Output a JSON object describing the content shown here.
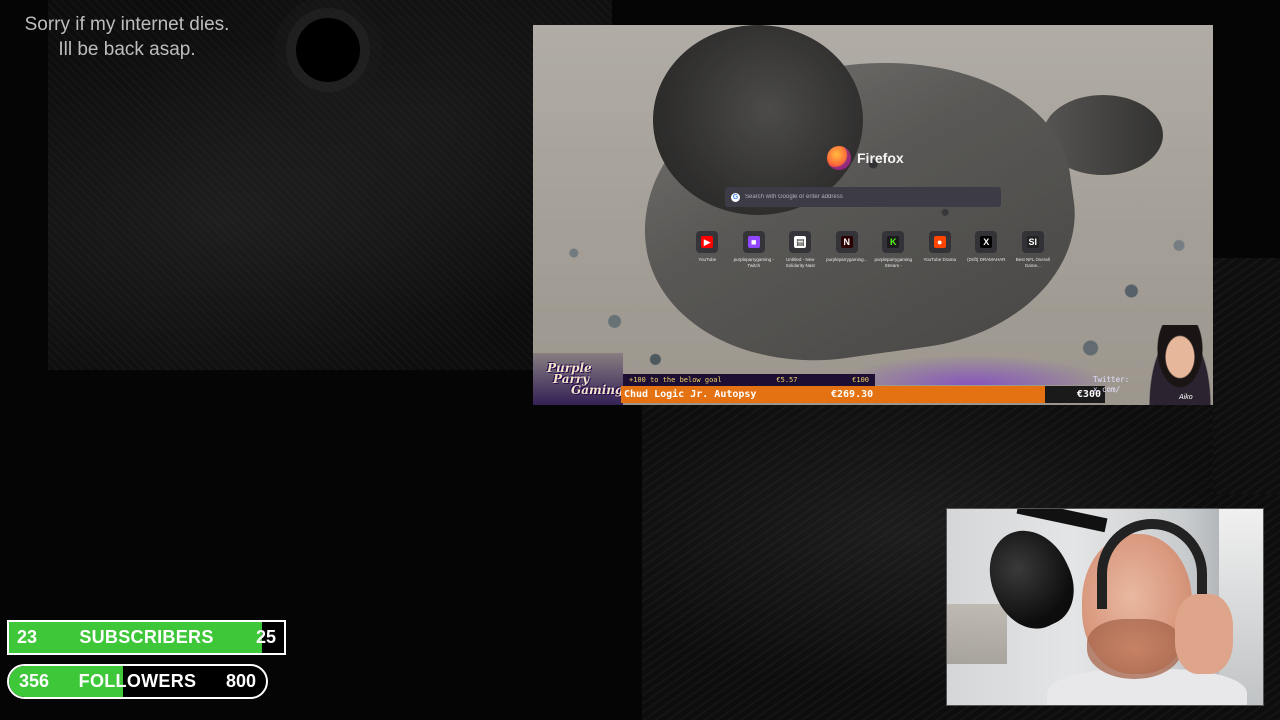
{
  "notice": {
    "line1": "Sorry if my internet dies.",
    "line2": "Ill be back asap."
  },
  "browser": {
    "brand": "Firefox",
    "search_placeholder": "Search with Google or enter address",
    "search_engine_icon": "G",
    "shortcuts": [
      {
        "icon": "youtube-icon",
        "glyph": "▶",
        "bg": "#ff0000",
        "label": "YouTube"
      },
      {
        "icon": "twitch-icon",
        "glyph": "■",
        "bg": "#9146ff",
        "label": "purpleparrygaming - Twitch"
      },
      {
        "icon": "document-icon",
        "glyph": "▤",
        "bg": "#ffffff",
        "label": "Untitled - New Solidarity Nast"
      },
      {
        "icon": "netflix-icon",
        "glyph": "N",
        "bg": "#2a0000",
        "label": "purpleparrygaming..."
      },
      {
        "icon": "kick-icon",
        "glyph": "K",
        "bg": "#1a1a1a",
        "label": "purpleparrygaming Stream -"
      },
      {
        "icon": "reddit-icon",
        "glyph": "●",
        "bg": "#ff4500",
        "label": "YouTube Drama"
      },
      {
        "icon": "x-icon",
        "glyph": "X",
        "bg": "#000000",
        "label": "(Drift) DRAMAHAR"
      },
      {
        "icon": "si-icon",
        "glyph": "SI",
        "bg": "#222222",
        "label": "Best NFL Overall Game..."
      }
    ]
  },
  "stream_overlay": {
    "logo_line1": "Purple",
    "logo_line2": "Parry",
    "logo_line3": "Gaming",
    "goal_strip_left": "+100 to the below goal",
    "goal_strip_mid": "€5.57",
    "goal_strip_right": "€100",
    "goal_title": "Chud Logic Jr. Autopsy",
    "goal_amount": "€269.30",
    "goal_target": "€300",
    "twitter_line1": "Twitter:",
    "twitter_line2": "x.com/",
    "guest_name": "Aiko"
  },
  "subscribers_goal": {
    "current": "23",
    "label": "SUBSCRIBERS",
    "target": "25",
    "progress": 0.92
  },
  "followers_goal": {
    "current": "356",
    "label": "FOLLOWERS",
    "target": "800",
    "progress": 0.445
  },
  "colors": {
    "goal_green": "#3fc73a",
    "donation_orange": "#e57212",
    "overlay_purple": "#1c0f33"
  }
}
